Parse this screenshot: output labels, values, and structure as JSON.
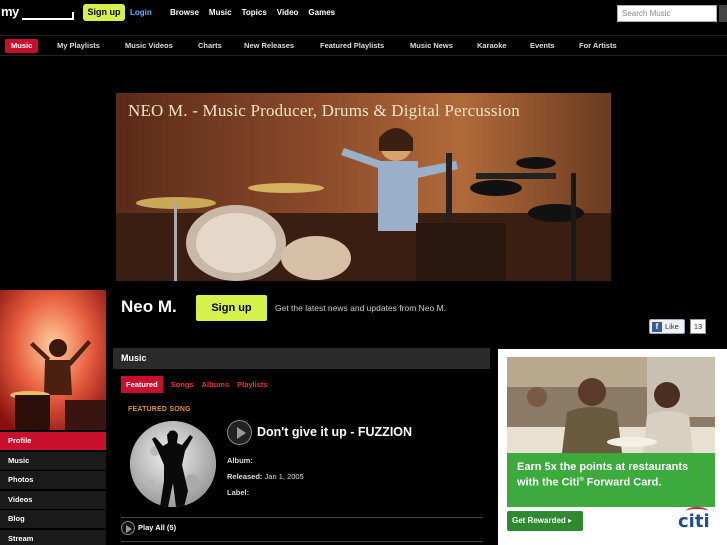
{
  "topbar": {
    "logo": "my",
    "signup": "Sign up",
    "login": "Login",
    "nav": [
      "Browse",
      "Music",
      "Topics",
      "Video",
      "Games"
    ],
    "search_placeholder": "Search Music"
  },
  "subnav": {
    "items": [
      "Music",
      "My Playlists",
      "Music Videos",
      "Charts",
      "New Releases",
      "Featured Playlists",
      "Music News",
      "Karaoke",
      "Events",
      "For Artists"
    ]
  },
  "banner": {
    "title": "NEO M.  - Music Producer, Drums & Digital Percussion"
  },
  "artist": {
    "name": "Neo M.",
    "signup": "Sign up",
    "tagline": "Get the latest news and updates from Neo M."
  },
  "facebook": {
    "like_label": "Like",
    "count": "13"
  },
  "leftnav": {
    "items": [
      "Profile",
      "Music",
      "Photos",
      "Videos",
      "Blog",
      "Stream"
    ]
  },
  "music": {
    "header": "Music",
    "tabs": [
      "Featured",
      "Songs",
      "Albums",
      "Playlists"
    ],
    "featured_label": "FEATURED SONG",
    "song_title": "Don't give it up - FUZZION",
    "album_label": "Album:",
    "album_value": "",
    "released_label": "Released:",
    "released_value": "Jan 1, 2005",
    "label_label": "Label:",
    "label_value": "",
    "play_all": "Play All (5)"
  },
  "ad": {
    "headline_1": "Earn 5x the points at restaurants",
    "headline_2": "with the Citi",
    "headline_sup": "®",
    "headline_3": " Forward Card.",
    "button": "Get Rewarded ▸",
    "logo": "citi"
  },
  "colors": {
    "accent_red": "#c8102e",
    "signup_green": "#d6f24a",
    "link_blue": "#5ab4ff",
    "featured_orange": "#e09030",
    "ad_green": "#3caa3c"
  }
}
